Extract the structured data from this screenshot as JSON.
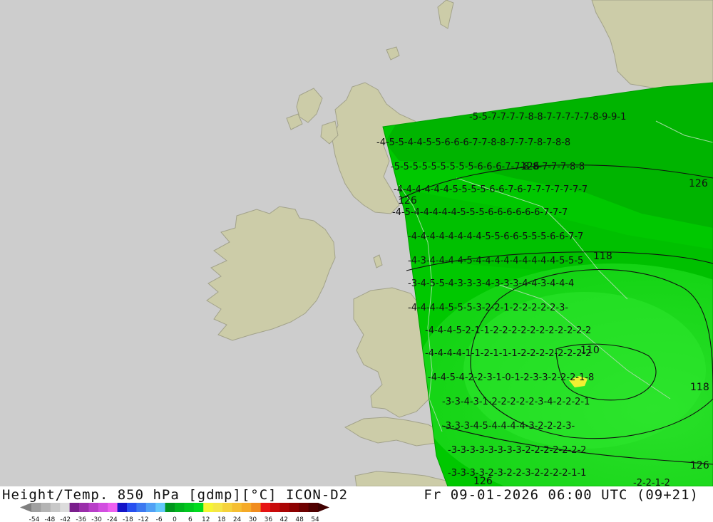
{
  "header": {
    "left_title": "Height/Temp. 850 hPa [gdmp][°C] ICON-D2",
    "right_title": "Fr 09-01-2026 06:00 UTC (09+21)"
  },
  "legend": {
    "ticks": [
      "-54",
      "-48",
      "-42",
      "-36",
      "-30",
      "-24",
      "-18",
      "-12",
      "-6",
      "0",
      "6",
      "12",
      "18",
      "24",
      "30",
      "36",
      "42",
      "48",
      "54"
    ],
    "colors": [
      "#a0a0a0",
      "#b4b4b4",
      "#c8c8c8",
      "#dcdcdc",
      "#7a1e8c",
      "#9a2eaa",
      "#b83ec8",
      "#d24ee0",
      "#ee60f0",
      "#1414c8",
      "#2850f0",
      "#3c78f0",
      "#50a0f5",
      "#64c8fa",
      "#00961e",
      "#00b41e",
      "#00c81e",
      "#00dc1e",
      "#f5f532",
      "#f5e646",
      "#f5d23c",
      "#f5be32",
      "#f5aa28",
      "#f08c1e",
      "#e61414",
      "#c80a0a",
      "#aa0505",
      "#8c0000",
      "#6e0000",
      "#500000"
    ]
  },
  "map": {
    "colors": {
      "sea": "#cdcdcd",
      "land": "#cccca8",
      "coast": "#a2a28a",
      "field_dark": "#00b000",
      "field_mid": "#00c800",
      "field_light": "#14dc14",
      "warm_spot": "#f0f032"
    },
    "contours": [
      {
        "label_a": "126",
        "label_b": "126",
        "label_c": "126"
      },
      {
        "label_a": "118"
      },
      {
        "label_a": "110"
      },
      {
        "label_a": "118"
      },
      {
        "label_a": "126",
        "label_b": "126"
      }
    ],
    "temperature_rows": [
      "-5-5-7-7-7-7-8-8-7-7-7-7-7-8-9-9-1",
      "-4-5-5-4-4-5-5-6-6-6-7-7-8-8-7-7-7-8-7-8-8",
      "-5-5-5-5-5-5-5-5-5-6-6-6-7-7-8-8-7-7-7-8-8",
      "-4-4-4-4-4-4-5-5-5-5-6-6-7-6-7-7-7-7-7-7-7",
      "-4-5-4-4-4-4-4-5-5-5-6-6-6-6-6-6-7-7-7",
      "-4-4-4-4-4-4-4-4-5-5-6-6-5-5-5-6-6-7-7",
      "-4-3-4-4-4-4-5-4-4-4-4-4-4-4-4-4-5-5-5",
      "-3-4-5-5-4-3-3-3-4-3-3-3-4-4-3-4-4-4",
      "-4-4-4-4-5-5-5-3-2-2-1-2-2-2-2-2-3-",
      "-4-4-4-5-2-1-1-2-2-2-2-2-2-2-2-2-2-2",
      "-4-4-4-4-1-1-2-1-1-1-2-2-2-2-2-2-2-2",
      "-4-4-5-4-2-2-3-1-0-1-2-3-3-2-2-2-1-8",
      "-3-3-4-3-1-2-2-2-2-2-3-4-2-2-2-1",
      "-3-3-3-4-5-4-4-4-4-3-2-2-2-3-",
      "-3-3-3-3-3-3-3-3-2-2-2-2-2-2-2",
      "-3-3-3-3-2-3-2-2-3-2-2-2-2-1-1",
      "-2-2-1-2"
    ]
  }
}
